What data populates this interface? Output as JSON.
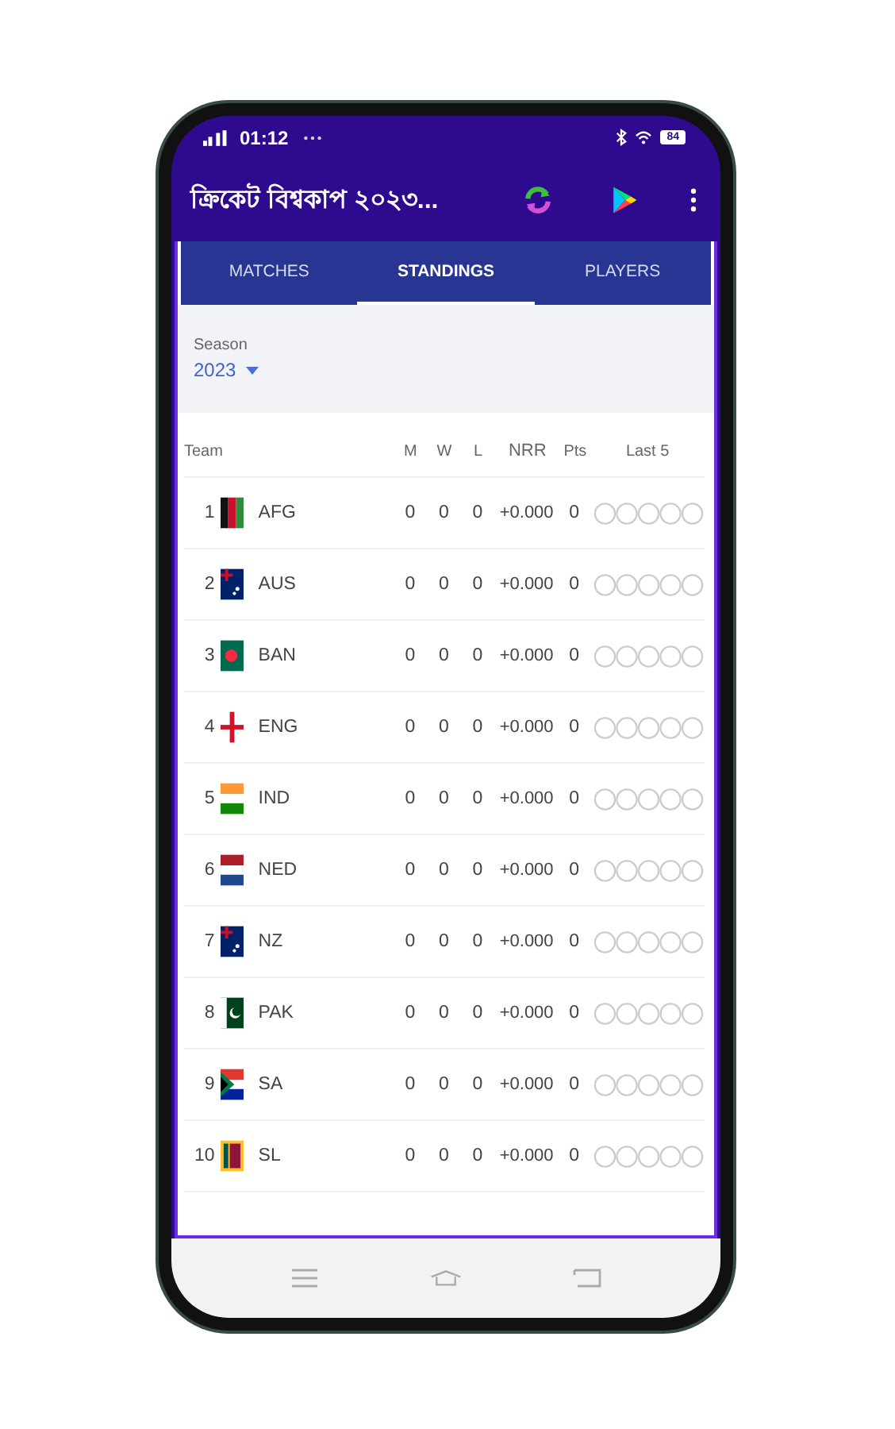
{
  "status_bar": {
    "time": "01:12",
    "battery": "84"
  },
  "app_bar": {
    "title": "ক্রিকেট বিশ্বকাপ ২০২৩..."
  },
  "tabs": [
    {
      "label": "MATCHES",
      "selected": false
    },
    {
      "label": "STANDINGS",
      "selected": true
    },
    {
      "label": "PLAYERS",
      "selected": false
    }
  ],
  "season": {
    "label": "Season",
    "value": "2023"
  },
  "table": {
    "columns": [
      "Team",
      "M",
      "W",
      "L",
      "NRR",
      "Pts",
      "Last 5"
    ],
    "rows": [
      {
        "rank": "1",
        "team": "AFG",
        "m": "0",
        "w": "0",
        "l": "0",
        "nrr": "+0.000",
        "pts": "0"
      },
      {
        "rank": "2",
        "team": "AUS",
        "m": "0",
        "w": "0",
        "l": "0",
        "nrr": "+0.000",
        "pts": "0"
      },
      {
        "rank": "3",
        "team": "BAN",
        "m": "0",
        "w": "0",
        "l": "0",
        "nrr": "+0.000",
        "pts": "0"
      },
      {
        "rank": "4",
        "team": "ENG",
        "m": "0",
        "w": "0",
        "l": "0",
        "nrr": "+0.000",
        "pts": "0"
      },
      {
        "rank": "5",
        "team": "IND",
        "m": "0",
        "w": "0",
        "l": "0",
        "nrr": "+0.000",
        "pts": "0"
      },
      {
        "rank": "6",
        "team": "NED",
        "m": "0",
        "w": "0",
        "l": "0",
        "nrr": "+0.000",
        "pts": "0"
      },
      {
        "rank": "7",
        "team": "NZ",
        "m": "0",
        "w": "0",
        "l": "0",
        "nrr": "+0.000",
        "pts": "0"
      },
      {
        "rank": "8",
        "team": "PAK",
        "m": "0",
        "w": "0",
        "l": "0",
        "nrr": "+0.000",
        "pts": "0"
      },
      {
        "rank": "9",
        "team": "SA",
        "m": "0",
        "w": "0",
        "l": "0",
        "nrr": "+0.000",
        "pts": "0"
      },
      {
        "rank": "10",
        "team": "SL",
        "m": "0",
        "w": "0",
        "l": "0",
        "nrr": "+0.000",
        "pts": "0"
      }
    ]
  }
}
